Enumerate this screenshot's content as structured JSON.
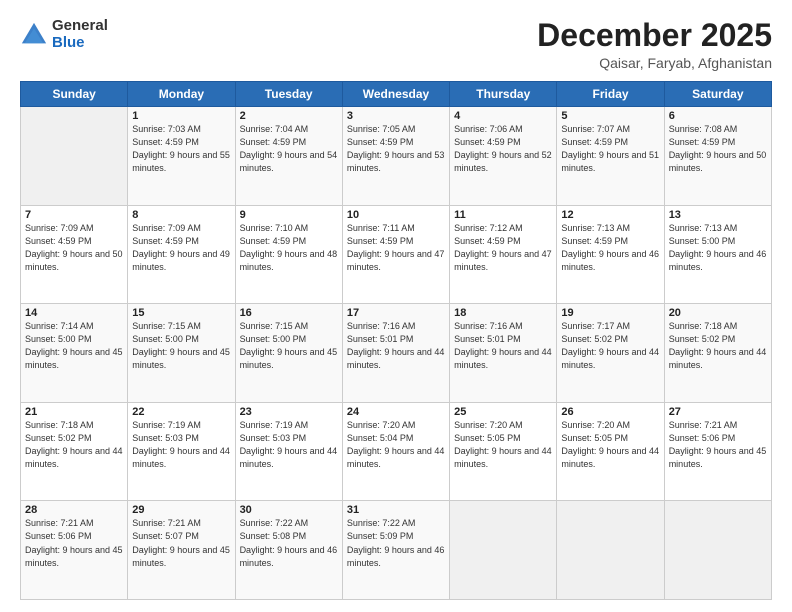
{
  "header": {
    "logo_general": "General",
    "logo_blue": "Blue",
    "main_title": "December 2025",
    "subtitle": "Qaisar, Faryab, Afghanistan"
  },
  "days_of_week": [
    "Sunday",
    "Monday",
    "Tuesday",
    "Wednesday",
    "Thursday",
    "Friday",
    "Saturday"
  ],
  "weeks": [
    [
      {
        "day": "",
        "sunrise": "",
        "sunset": "",
        "daylight": ""
      },
      {
        "day": "1",
        "sunrise": "7:03 AM",
        "sunset": "4:59 PM",
        "daylight": "9 hours and 55 minutes."
      },
      {
        "day": "2",
        "sunrise": "7:04 AM",
        "sunset": "4:59 PM",
        "daylight": "9 hours and 54 minutes."
      },
      {
        "day": "3",
        "sunrise": "7:05 AM",
        "sunset": "4:59 PM",
        "daylight": "9 hours and 53 minutes."
      },
      {
        "day": "4",
        "sunrise": "7:06 AM",
        "sunset": "4:59 PM",
        "daylight": "9 hours and 52 minutes."
      },
      {
        "day": "5",
        "sunrise": "7:07 AM",
        "sunset": "4:59 PM",
        "daylight": "9 hours and 51 minutes."
      },
      {
        "day": "6",
        "sunrise": "7:08 AM",
        "sunset": "4:59 PM",
        "daylight": "9 hours and 50 minutes."
      }
    ],
    [
      {
        "day": "7",
        "sunrise": "7:09 AM",
        "sunset": "4:59 PM",
        "daylight": "9 hours and 50 minutes."
      },
      {
        "day": "8",
        "sunrise": "7:09 AM",
        "sunset": "4:59 PM",
        "daylight": "9 hours and 49 minutes."
      },
      {
        "day": "9",
        "sunrise": "7:10 AM",
        "sunset": "4:59 PM",
        "daylight": "9 hours and 48 minutes."
      },
      {
        "day": "10",
        "sunrise": "7:11 AM",
        "sunset": "4:59 PM",
        "daylight": "9 hours and 47 minutes."
      },
      {
        "day": "11",
        "sunrise": "7:12 AM",
        "sunset": "4:59 PM",
        "daylight": "9 hours and 47 minutes."
      },
      {
        "day": "12",
        "sunrise": "7:13 AM",
        "sunset": "4:59 PM",
        "daylight": "9 hours and 46 minutes."
      },
      {
        "day": "13",
        "sunrise": "7:13 AM",
        "sunset": "5:00 PM",
        "daylight": "9 hours and 46 minutes."
      }
    ],
    [
      {
        "day": "14",
        "sunrise": "7:14 AM",
        "sunset": "5:00 PM",
        "daylight": "9 hours and 45 minutes."
      },
      {
        "day": "15",
        "sunrise": "7:15 AM",
        "sunset": "5:00 PM",
        "daylight": "9 hours and 45 minutes."
      },
      {
        "day": "16",
        "sunrise": "7:15 AM",
        "sunset": "5:00 PM",
        "daylight": "9 hours and 45 minutes."
      },
      {
        "day": "17",
        "sunrise": "7:16 AM",
        "sunset": "5:01 PM",
        "daylight": "9 hours and 44 minutes."
      },
      {
        "day": "18",
        "sunrise": "7:16 AM",
        "sunset": "5:01 PM",
        "daylight": "9 hours and 44 minutes."
      },
      {
        "day": "19",
        "sunrise": "7:17 AM",
        "sunset": "5:02 PM",
        "daylight": "9 hours and 44 minutes."
      },
      {
        "day": "20",
        "sunrise": "7:18 AM",
        "sunset": "5:02 PM",
        "daylight": "9 hours and 44 minutes."
      }
    ],
    [
      {
        "day": "21",
        "sunrise": "7:18 AM",
        "sunset": "5:02 PM",
        "daylight": "9 hours and 44 minutes."
      },
      {
        "day": "22",
        "sunrise": "7:19 AM",
        "sunset": "5:03 PM",
        "daylight": "9 hours and 44 minutes."
      },
      {
        "day": "23",
        "sunrise": "7:19 AM",
        "sunset": "5:03 PM",
        "daylight": "9 hours and 44 minutes."
      },
      {
        "day": "24",
        "sunrise": "7:20 AM",
        "sunset": "5:04 PM",
        "daylight": "9 hours and 44 minutes."
      },
      {
        "day": "25",
        "sunrise": "7:20 AM",
        "sunset": "5:05 PM",
        "daylight": "9 hours and 44 minutes."
      },
      {
        "day": "26",
        "sunrise": "7:20 AM",
        "sunset": "5:05 PM",
        "daylight": "9 hours and 44 minutes."
      },
      {
        "day": "27",
        "sunrise": "7:21 AM",
        "sunset": "5:06 PM",
        "daylight": "9 hours and 45 minutes."
      }
    ],
    [
      {
        "day": "28",
        "sunrise": "7:21 AM",
        "sunset": "5:06 PM",
        "daylight": "9 hours and 45 minutes."
      },
      {
        "day": "29",
        "sunrise": "7:21 AM",
        "sunset": "5:07 PM",
        "daylight": "9 hours and 45 minutes."
      },
      {
        "day": "30",
        "sunrise": "7:22 AM",
        "sunset": "5:08 PM",
        "daylight": "9 hours and 46 minutes."
      },
      {
        "day": "31",
        "sunrise": "7:22 AM",
        "sunset": "5:09 PM",
        "daylight": "9 hours and 46 minutes."
      },
      {
        "day": "",
        "sunrise": "",
        "sunset": "",
        "daylight": ""
      },
      {
        "day": "",
        "sunrise": "",
        "sunset": "",
        "daylight": ""
      },
      {
        "day": "",
        "sunrise": "",
        "sunset": "",
        "daylight": ""
      }
    ]
  ],
  "labels": {
    "sunrise": "Sunrise:",
    "sunset": "Sunset:",
    "daylight": "Daylight:"
  }
}
